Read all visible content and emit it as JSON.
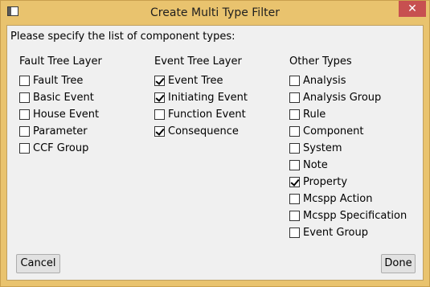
{
  "window": {
    "title": "Create Multi Type Filter",
    "close_glyph": "✕"
  },
  "prompt": "Please specify the list of component types:",
  "columns": [
    {
      "header": "Fault Tree Layer",
      "items": [
        {
          "label": "Fault Tree",
          "checked": false
        },
        {
          "label": "Basic Event",
          "checked": false
        },
        {
          "label": "House Event",
          "checked": false
        },
        {
          "label": "Parameter",
          "checked": false
        },
        {
          "label": "CCF Group",
          "checked": false
        }
      ]
    },
    {
      "header": "Event Tree Layer",
      "items": [
        {
          "label": "Event Tree",
          "checked": true
        },
        {
          "label": "Initiating Event",
          "checked": true
        },
        {
          "label": "Function Event",
          "checked": false
        },
        {
          "label": "Consequence",
          "checked": true
        }
      ]
    },
    {
      "header": "Other Types",
      "items": [
        {
          "label": "Analysis",
          "checked": false
        },
        {
          "label": "Analysis Group",
          "checked": false
        },
        {
          "label": "Rule",
          "checked": false
        },
        {
          "label": "Component",
          "checked": false
        },
        {
          "label": "System",
          "checked": false
        },
        {
          "label": "Note",
          "checked": false
        },
        {
          "label": "Property",
          "checked": true
        },
        {
          "label": "Mcspp Action",
          "checked": false
        },
        {
          "label": "Mcspp Specification",
          "checked": false
        },
        {
          "label": "Event Group",
          "checked": false
        }
      ]
    }
  ],
  "buttons": {
    "cancel": "Cancel",
    "done": "Done"
  },
  "colors": {
    "frame": "#e9c36e",
    "close_button": "#c75050",
    "client_background": "#f0f0f0"
  }
}
